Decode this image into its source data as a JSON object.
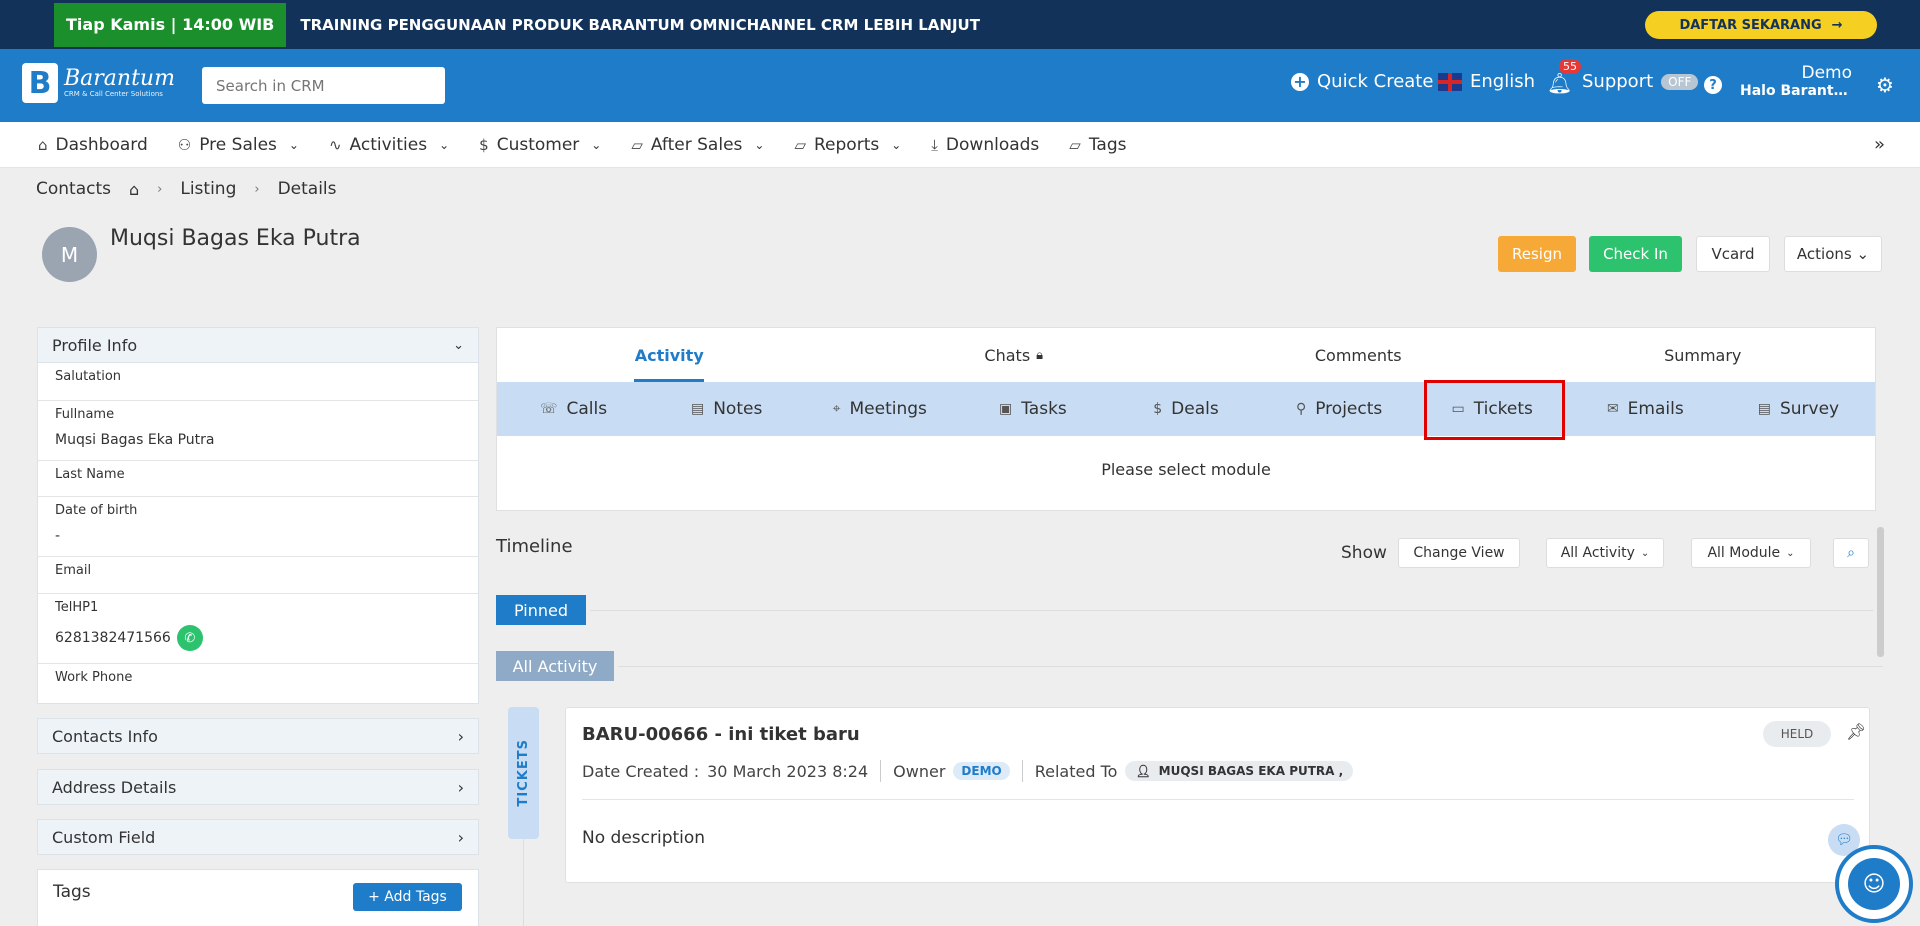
{
  "banner": {
    "schedule": "Tiap Kamis | 14:00 WIB",
    "headline": "TRAINING PENGGUNAAN PRODUK BARANTUM OMNICHANNEL CRM LEBIH LANJUT",
    "cta": "DAFTAR SEKARANG",
    "cta_arrow": "→"
  },
  "header": {
    "logo_mark": "B",
    "logo_name": "Barantum",
    "logo_tagline": "CRM & Call Center Solutions",
    "search_placeholder": "Search in CRM",
    "quick_create": "Quick Create",
    "language": "English",
    "notification_count": "55",
    "support": "Support",
    "support_status": "OFF",
    "help_glyph": "?",
    "user_name": "Demo",
    "user_greeting": "Halo Barantum Demo",
    "gear_glyph": "⚙"
  },
  "nav": {
    "items": [
      {
        "label": "Dashboard",
        "icon": "⌂",
        "has_dropdown": false
      },
      {
        "label": "Pre Sales",
        "icon": "👥",
        "has_dropdown": true
      },
      {
        "label": "Activities",
        "icon": "〰",
        "has_dropdown": true
      },
      {
        "label": "Customer",
        "icon": "$",
        "has_dropdown": true
      },
      {
        "label": "After Sales",
        "icon": "🗀",
        "has_dropdown": true
      },
      {
        "label": "Reports",
        "icon": "🗀",
        "has_dropdown": true
      },
      {
        "label": "Downloads",
        "icon": "⤓",
        "has_dropdown": false
      },
      {
        "label": "Tags",
        "icon": "🗀",
        "has_dropdown": false
      }
    ],
    "expand_glyph": "»"
  },
  "breadcrumb": {
    "section": "Contacts",
    "home_icon": "⌂",
    "items": [
      "Listing",
      "Details"
    ]
  },
  "contact": {
    "initial": "M",
    "name": "Muqsi Bagas Eka Putra",
    "buttons": {
      "resign": "Resign",
      "check_in": "Check In",
      "vcard": "Vcard",
      "actions": "Actions ⌄"
    }
  },
  "profile": {
    "title": "Profile Info",
    "fields": [
      {
        "label": "Salutation",
        "value": ""
      },
      {
        "label": "Fullname",
        "value": "Muqsi Bagas Eka Putra"
      },
      {
        "label": "Last Name",
        "value": ""
      },
      {
        "label": "Date of birth",
        "value": "-"
      },
      {
        "label": "Email",
        "value": ""
      },
      {
        "label": "TelHP1",
        "value": "6281382471566"
      },
      {
        "label": "Work Phone",
        "value": ""
      }
    ],
    "sections": [
      "Contacts Info",
      "Address Details",
      "Custom Field"
    ],
    "tags_label": "Tags",
    "add_tags": "+ Add Tags"
  },
  "activity": {
    "tabs": [
      {
        "label": "Activity",
        "active": true
      },
      {
        "label": "Chats",
        "active": false,
        "icon": "🔒"
      },
      {
        "label": "Comments",
        "active": false
      },
      {
        "label": "Summary",
        "active": false
      }
    ],
    "modules": [
      {
        "label": "Calls",
        "icon": "☏"
      },
      {
        "label": "Notes",
        "icon": "▤"
      },
      {
        "label": "Meetings",
        "icon": "⌖"
      },
      {
        "label": "Tasks",
        "icon": "▣"
      },
      {
        "label": "Deals",
        "icon": "$"
      },
      {
        "label": "Projects",
        "icon": "⚲"
      },
      {
        "label": "Tickets",
        "icon": "▭",
        "highlighted": true
      },
      {
        "label": "Emails",
        "icon": "✉"
      },
      {
        "label": "Survey",
        "icon": "▤"
      }
    ],
    "empty_message": "Please select module"
  },
  "timeline": {
    "title": "Timeline",
    "show_label": "Show",
    "change_view": "Change View",
    "activity_filter": "All Activity",
    "module_filter": "All Module",
    "pinned": "Pinned",
    "all_activity": "All Activity"
  },
  "ticket": {
    "type_label": "TICKETS",
    "title": "BARU-00666 - ini tiket baru",
    "date_label": "Date Created :",
    "date_value": "30 March 2023 8:24",
    "owner_label": "Owner",
    "owner_value": "DEMO",
    "related_label": "Related To",
    "related_value": "MUQSI BAGAS EKA PUTRA ,",
    "status": "HELD",
    "description": "No description"
  },
  "colors": {
    "brand_blue": "#1e7cc8",
    "banner_navy": "#13325a",
    "banner_green": "#1a8f2c",
    "cta_yellow": "#f5cf22",
    "resign_orange": "#f7a937",
    "checkin_green": "#2dc26e",
    "module_bar": "#c8dcf3",
    "highlight_red": "#e00000"
  }
}
